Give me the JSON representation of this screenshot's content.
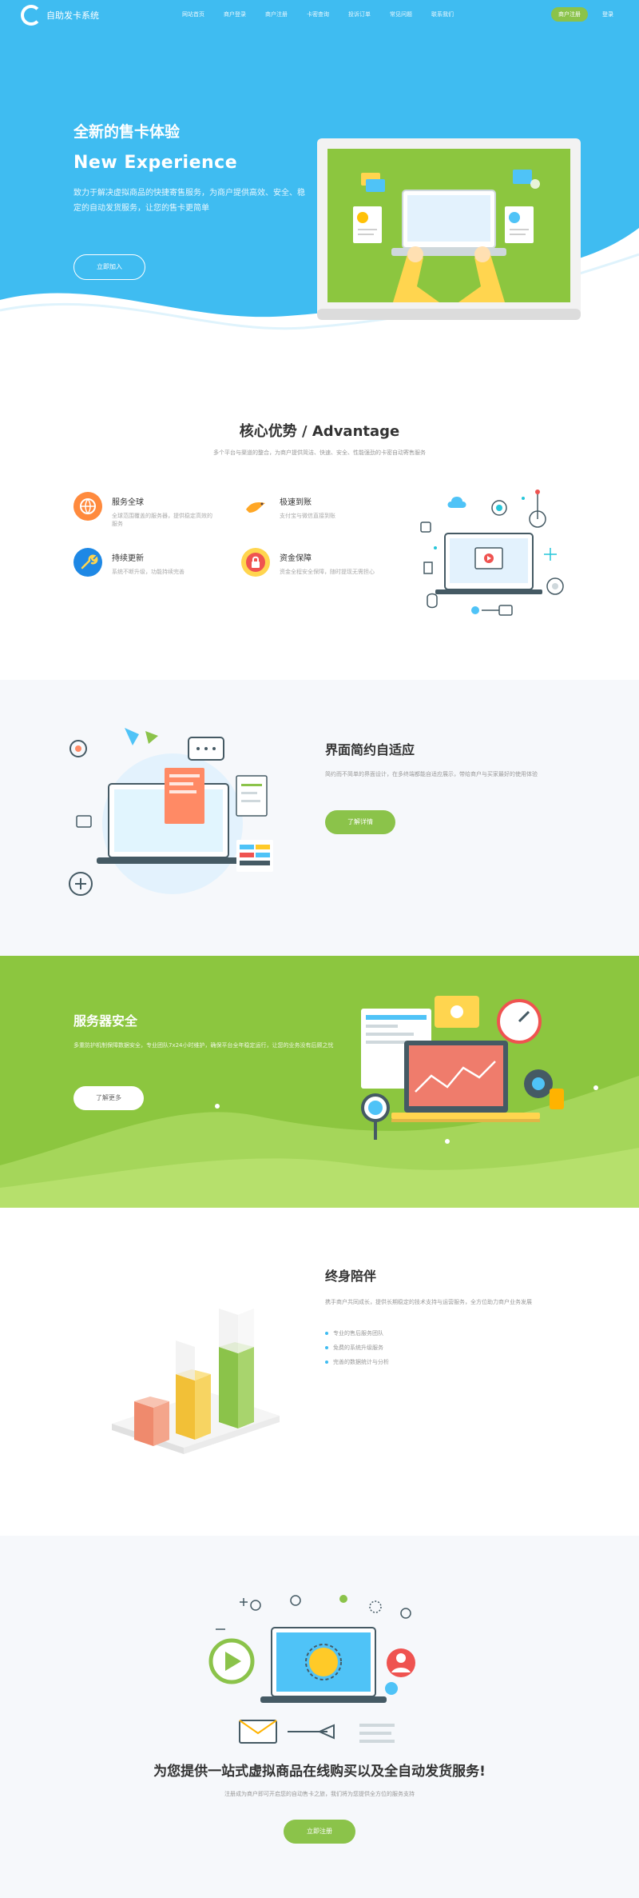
{
  "header": {
    "logo_text": "自助发卡系统",
    "nav_items": [
      "网站首页",
      "商户登录",
      "商户注册",
      "卡密查询",
      "投诉订单",
      "常见问题",
      "联系我们"
    ],
    "cta_label": "商户注册",
    "login_label": "登录"
  },
  "hero": {
    "title": "全新的售卡体验",
    "subtitle": "New Experience",
    "description": "致力于解决虚拟商品的快捷寄售服务，为商户提供高效、安全、稳定的自动发货服务，让您的售卡更简单",
    "button_label": "立即加入"
  },
  "advantages": {
    "title": "核心优势 / Advantage",
    "description": "多个平台与渠道的整合，为商户提供简洁、快速、安全、性能强劲的卡密自动寄售服务",
    "features": [
      {
        "title": "服务全球",
        "text": "全球范围覆盖的服务器，提供稳定高效的服务"
      },
      {
        "title": "极速到账",
        "text": "支付宝与微信直接到账"
      },
      {
        "title": "持续更新",
        "text": "系统不断升级，功能持续完善"
      },
      {
        "title": "资金保障",
        "text": "资金全程安全保障，随时提现无需担心"
      }
    ]
  },
  "simple_ui": {
    "title": "界面简约自适应",
    "description": "简约而不简单的界面设计，在多终端都能自适应展示，带给商户与买家最好的使用体验",
    "button_label": "了解详情"
  },
  "security": {
    "title": "服务器安全",
    "description": "多重防护机制保障数据安全，专业团队7x24小时维护，确保平台全年稳定运行，让您的业务没有后顾之忧",
    "button_label": "了解更多"
  },
  "lifetime": {
    "title": "终身陪伴",
    "description": "携手商户共同成长，提供长期稳定的技术支持与运营服务，全方位助力商户业务发展",
    "list": [
      "专业的售后服务团队",
      "免费的系统升级服务",
      "完善的数据统计与分析"
    ]
  },
  "cta": {
    "title": "为您提供一站式虚拟商品在线购买以及全自动发货服务!",
    "description": "注册成为商户即可开启您的自动售卡之旅，我们将为您提供全方位的服务支持",
    "button_label": "立即注册"
  },
  "colors": {
    "primary_blue": "#3fbcf1",
    "accent_green": "#8bc34a"
  }
}
